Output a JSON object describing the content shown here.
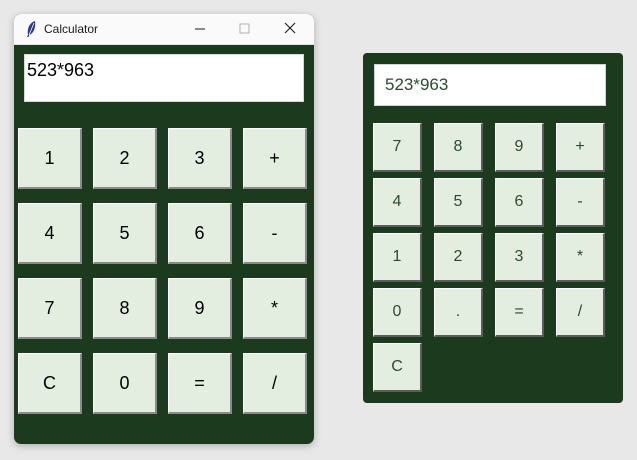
{
  "left_window": {
    "title": "Calculator",
    "display_value": "523*963",
    "keys": [
      "1",
      "2",
      "3",
      "+",
      "4",
      "5",
      "6",
      "-",
      "7",
      "8",
      "9",
      "*",
      "C",
      "0",
      "=",
      "/"
    ]
  },
  "right_window": {
    "display_value": "523*963",
    "keys": [
      "7",
      "8",
      "9",
      "+",
      "4",
      "5",
      "6",
      "-",
      "1",
      "2",
      "3",
      "*",
      "0",
      ".",
      "=",
      "/",
      "C"
    ]
  },
  "icons": {
    "app": "feather-icon",
    "minimize": "minimize-icon",
    "maximize": "maximize-icon",
    "close": "close-icon"
  },
  "colors": {
    "window_bg": "#1c3a1e",
    "key_bg": "#e3eee0",
    "display_bg": "#ffffff",
    "desktop_bg": "#e8e8e8"
  }
}
